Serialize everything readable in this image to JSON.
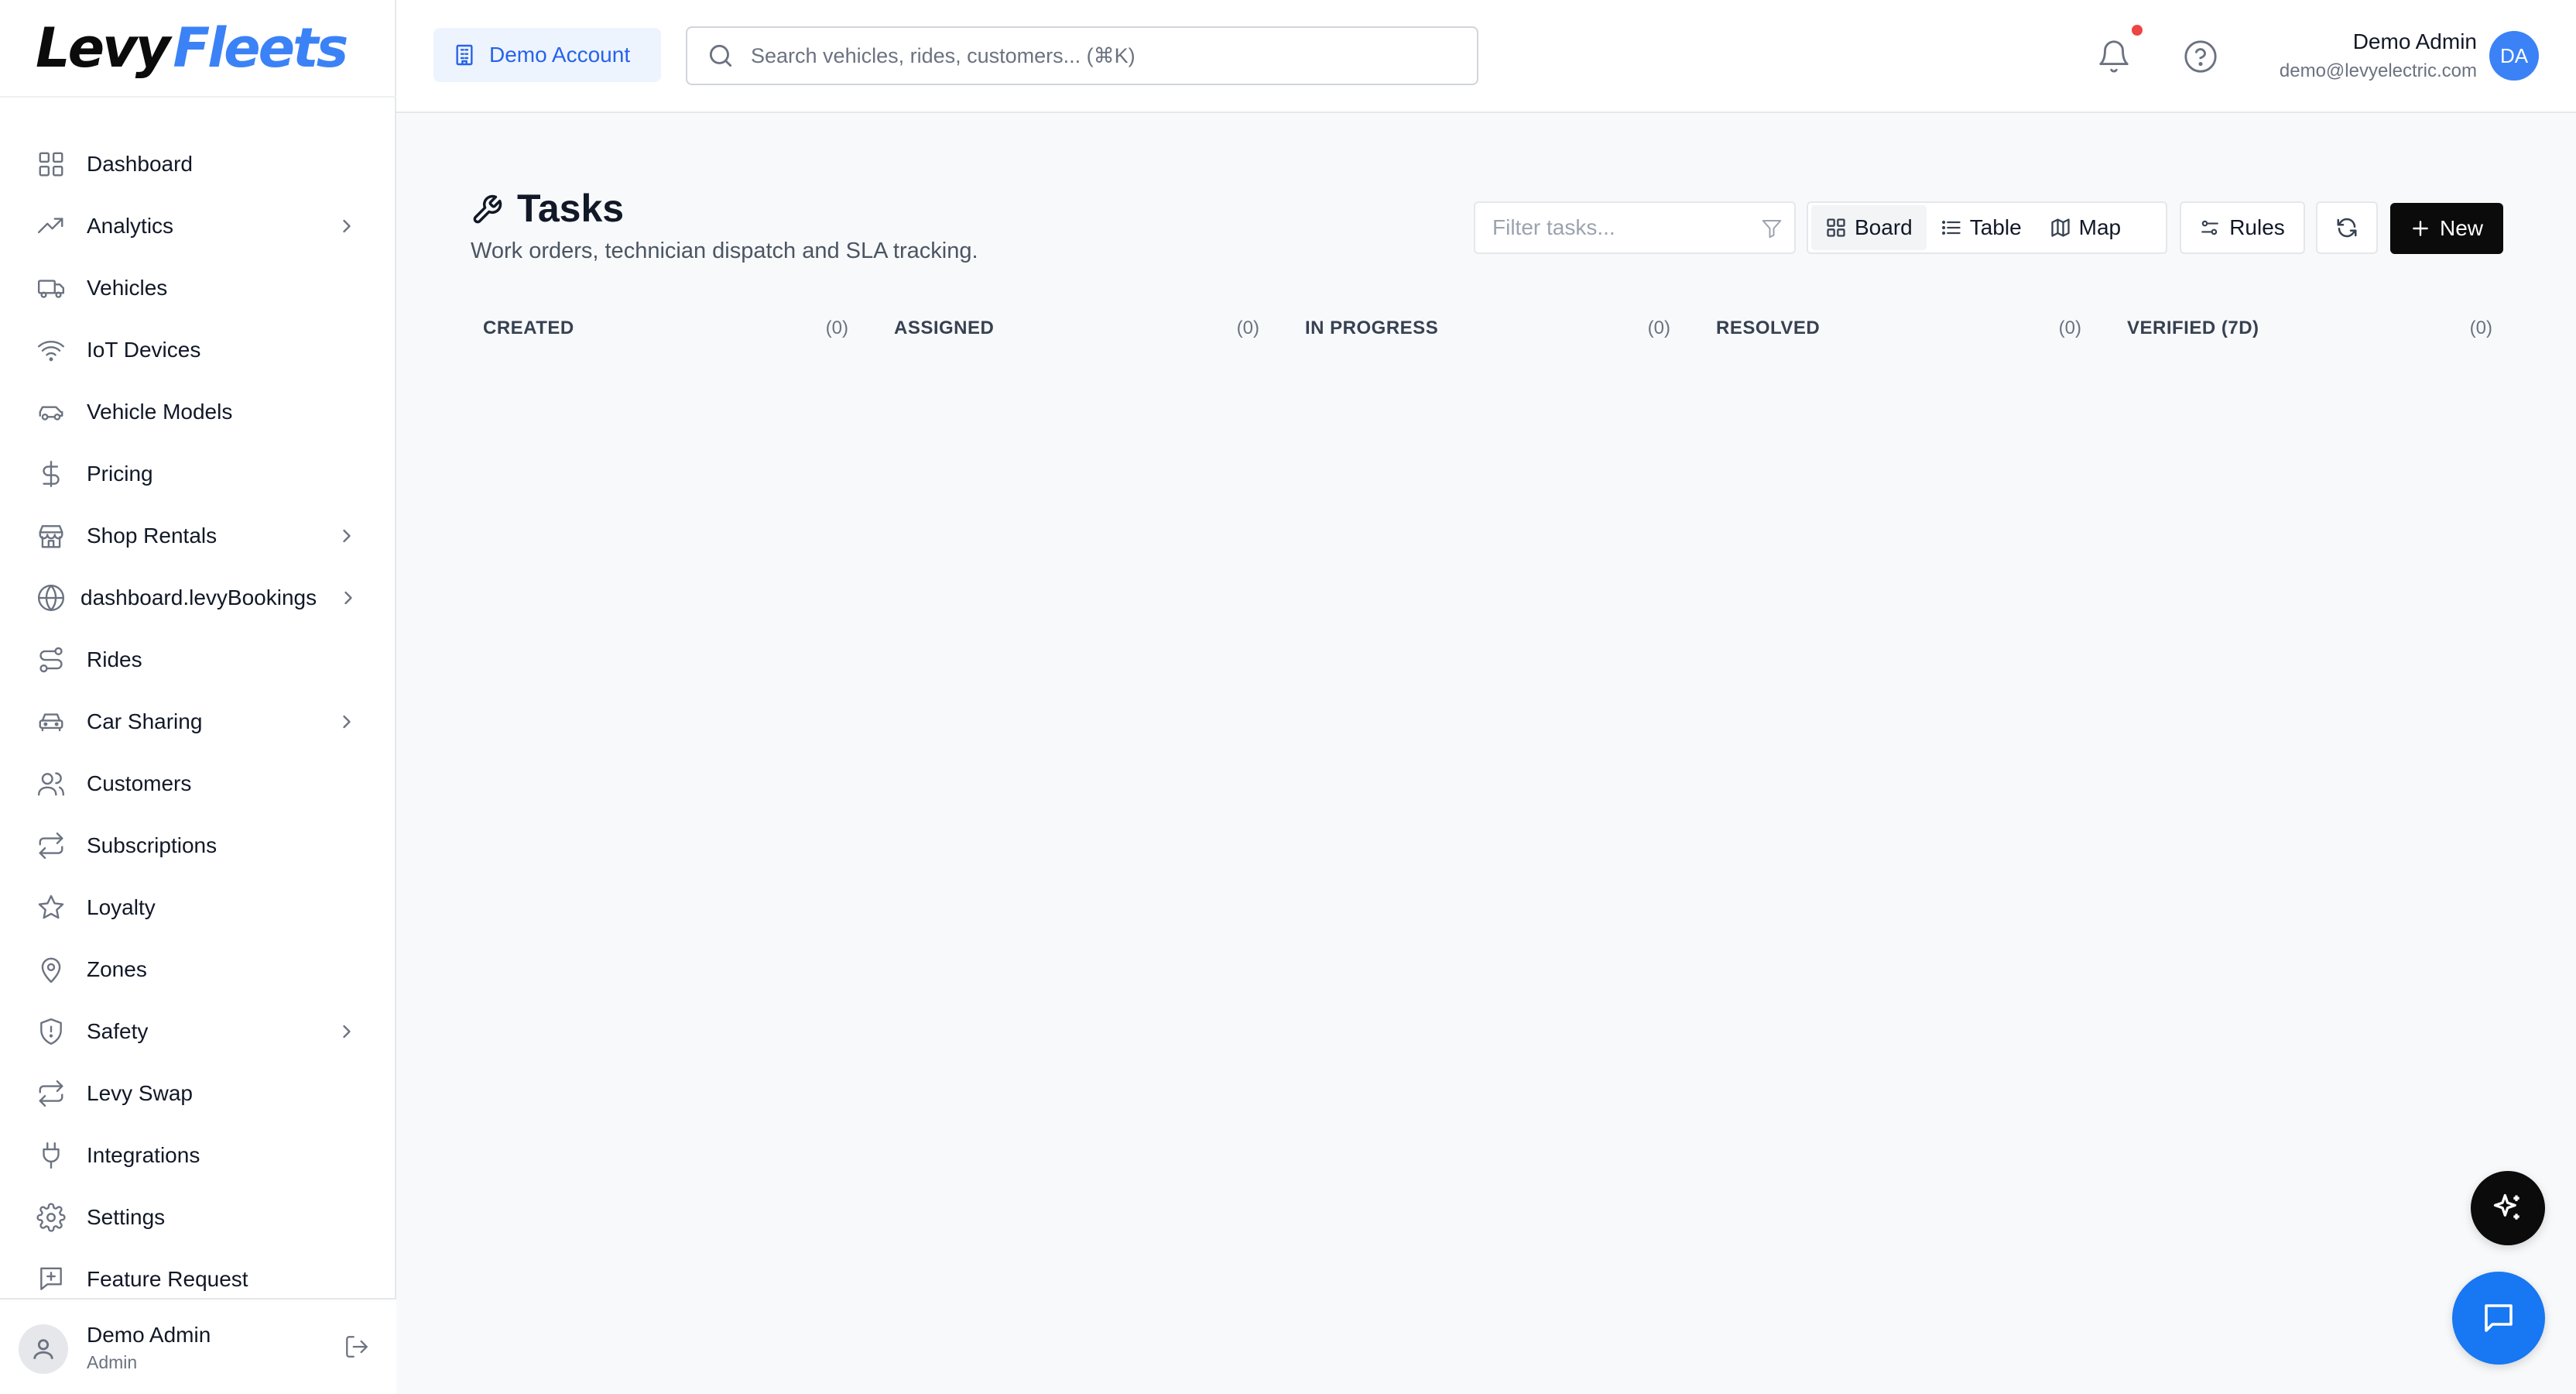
{
  "brand": {
    "logo_part1": "Levy",
    "logo_part2": "Fleets",
    "accent": "#3b82f6"
  },
  "sidebar": {
    "items": [
      {
        "label": "Dashboard",
        "icon": "grid-icon",
        "chevron": false
      },
      {
        "label": "Analytics",
        "icon": "trending-up-icon",
        "chevron": true
      },
      {
        "label": "Vehicles",
        "icon": "truck-icon",
        "chevron": false
      },
      {
        "label": "IoT Devices",
        "icon": "wifi-icon",
        "chevron": false
      },
      {
        "label": "Vehicle Models",
        "icon": "car-icon",
        "chevron": false
      },
      {
        "label": "Pricing",
        "icon": "dollar-icon",
        "chevron": false
      },
      {
        "label": "Shop Rentals",
        "icon": "store-icon",
        "chevron": true
      },
      {
        "label": "dashboard.levyBookings",
        "icon": "globe-icon",
        "chevron": true
      },
      {
        "label": "Rides",
        "icon": "route-icon",
        "chevron": false
      },
      {
        "label": "Car Sharing",
        "icon": "car-front-icon",
        "chevron": true
      },
      {
        "label": "Customers",
        "icon": "users-icon",
        "chevron": false
      },
      {
        "label": "Subscriptions",
        "icon": "repeat-icon",
        "chevron": false
      },
      {
        "label": "Loyalty",
        "icon": "star-icon",
        "chevron": false
      },
      {
        "label": "Zones",
        "icon": "map-pin-icon",
        "chevron": false
      },
      {
        "label": "Safety",
        "icon": "shield-icon",
        "chevron": true
      },
      {
        "label": "Levy Swap",
        "icon": "swap-icon",
        "chevron": false
      },
      {
        "label": "Integrations",
        "icon": "plug-icon",
        "chevron": false
      },
      {
        "label": "Settings",
        "icon": "gear-icon",
        "chevron": false
      },
      {
        "label": "Feature Request",
        "icon": "message-plus-icon",
        "chevron": false
      }
    ],
    "footer": {
      "name": "Demo Admin",
      "role": "Admin"
    }
  },
  "header": {
    "account_label": "Demo Account",
    "search_placeholder": "Search vehicles, rides, customers... (⌘K)",
    "user_name": "Demo Admin",
    "user_email": "demo@levyelectric.com",
    "avatar_initials": "DA",
    "notification_dot_color": "#ef4444"
  },
  "page": {
    "title": "Tasks",
    "subtitle": "Work orders, technician dispatch and SLA tracking.",
    "filter_placeholder": "Filter tasks...",
    "views": [
      {
        "label": "Board",
        "icon": "grid-icon",
        "active": true
      },
      {
        "label": "Table",
        "icon": "list-icon",
        "active": false
      },
      {
        "label": "Map",
        "icon": "map-icon",
        "active": false
      }
    ],
    "rules_label": "Rules",
    "new_label": "New"
  },
  "board": {
    "columns": [
      {
        "title": "CREATED",
        "count": "(0)"
      },
      {
        "title": "ASSIGNED",
        "count": "(0)"
      },
      {
        "title": "IN PROGRESS",
        "count": "(0)"
      },
      {
        "title": "RESOLVED",
        "count": "(0)"
      },
      {
        "title": "VERIFIED (7D)",
        "count": "(0)"
      }
    ]
  }
}
